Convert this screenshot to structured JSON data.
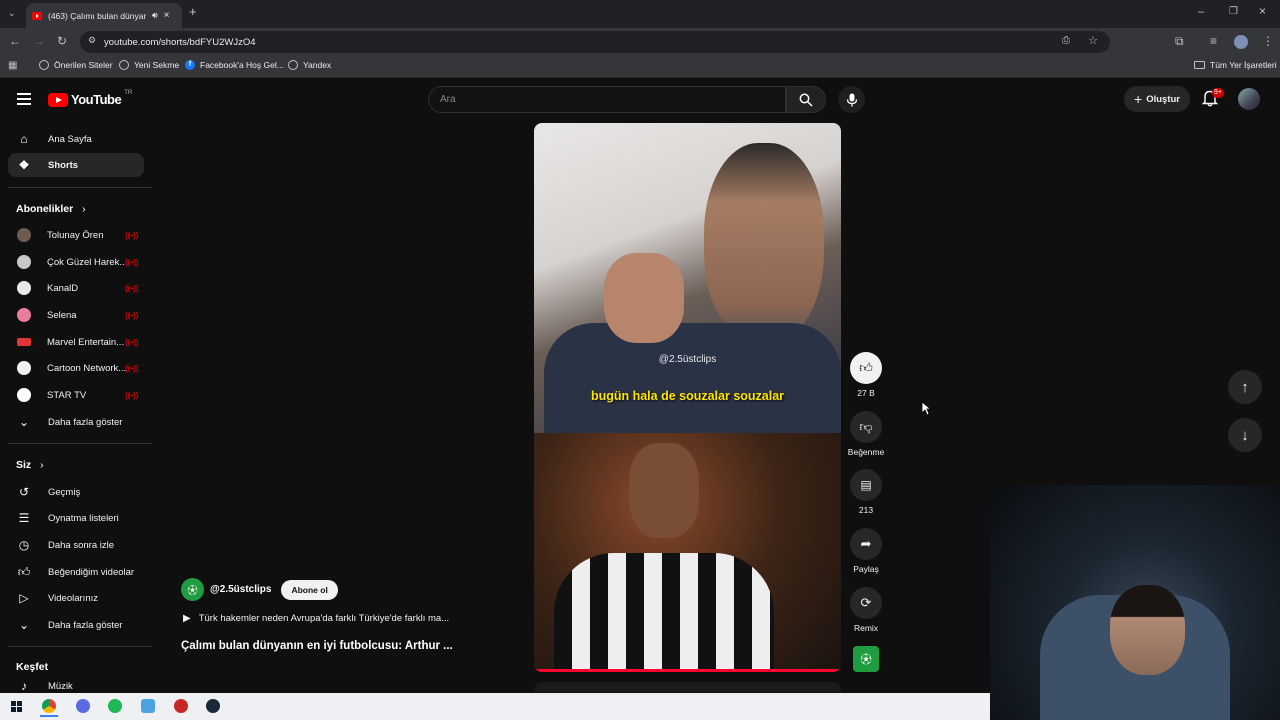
{
  "browser": {
    "tab_title": "(463) Çalımı bulan dünyan",
    "url": "youtube.com/shorts/bdFYU2WJzO4",
    "bookmarks": [
      "Önerilen Siteler",
      "Yeni Sekme",
      "Facebook'a Hoş Gel...",
      "Yandex"
    ],
    "all_bookmarks": "Tüm Yer İşaretleri"
  },
  "header": {
    "logo_text": "YouTube",
    "country": "TR",
    "search_placeholder": "Ara",
    "create_label": "Oluştur",
    "notifications": "9+"
  },
  "sidebar": {
    "main": [
      {
        "label": "Ana Sayfa",
        "icon": "home-icon"
      },
      {
        "label": "Shorts",
        "icon": "shorts-icon",
        "active": true
      }
    ],
    "subscriptions_title": "Abonelikler",
    "subscriptions": [
      {
        "label": "Tolunay Ören",
        "color": "#6d5b52"
      },
      {
        "label": "Çok Güzel Harek...",
        "color": "#c9c9c9"
      },
      {
        "label": "KanalD",
        "color": "#e9e9e9"
      },
      {
        "label": "Selena",
        "color": "#e87da0"
      },
      {
        "label": "Marvel Entertain...",
        "color": "#e23636"
      },
      {
        "label": "Cartoon Network...",
        "color": "#f1f1f1"
      },
      {
        "label": "STAR TV",
        "color": "#ffffff"
      }
    ],
    "show_more": "Daha fazla göster",
    "you_title": "Siz",
    "you_items": [
      {
        "label": "Geçmiş",
        "icon": "history-icon"
      },
      {
        "label": "Oynatma listeleri",
        "icon": "playlist-icon"
      },
      {
        "label": "Daha sonra izle",
        "icon": "clock-icon"
      },
      {
        "label": "Beğendiğim videolar",
        "icon": "thumbs-up-icon"
      },
      {
        "label": "Videolarınız",
        "icon": "video-icon"
      }
    ],
    "show_more_2": "Daha fazla göster",
    "explore_title": "Keşfet",
    "explore_items": [
      {
        "label": "Müzik",
        "icon": "music-icon"
      }
    ]
  },
  "video": {
    "watermark": "@2.5üstclips",
    "caption": "bugün hala de souzalar souzalar",
    "channel": "@2.5üstclips",
    "subscribe_label": "Abone ol",
    "linked_video": "Türk hakemler neden Avrupa'da farklı Türkiye'de farklı ma...",
    "title": "Çalımı bulan dünyanın en iyi futbolcusu: Arthur ..."
  },
  "actions": {
    "likes": "27 B",
    "dislike": "Beğenme",
    "comments": "213",
    "share": "Paylaş",
    "remix": "Remix"
  }
}
